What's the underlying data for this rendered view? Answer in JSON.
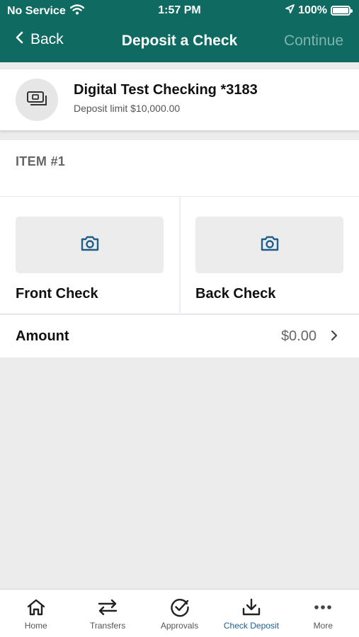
{
  "status_bar": {
    "carrier": "No Service",
    "time": "1:57 PM",
    "battery": "100%"
  },
  "nav": {
    "back_label": "Back",
    "title": "Deposit a Check",
    "continue_label": "Continue"
  },
  "account": {
    "name": "Digital Test Checking *3183",
    "limit": "Deposit limit $10,000.00"
  },
  "item": {
    "label": "ITEM #1"
  },
  "capture": {
    "front_label": "Front Check",
    "back_label": "Back Check"
  },
  "amount": {
    "label": "Amount",
    "value": "$0.00"
  },
  "tabs": [
    {
      "label": "Home",
      "icon": "home-icon"
    },
    {
      "label": "Transfers",
      "icon": "transfers-icon"
    },
    {
      "label": "Approvals",
      "icon": "check-circle-icon"
    },
    {
      "label": "Check Deposit",
      "icon": "download-tray-icon",
      "active": true
    },
    {
      "label": "More",
      "icon": "more-dots-icon"
    }
  ],
  "colors": {
    "header": "#0f6b62",
    "active_tab": "#1d5e8a",
    "camera_icon": "#1d5e8a"
  }
}
